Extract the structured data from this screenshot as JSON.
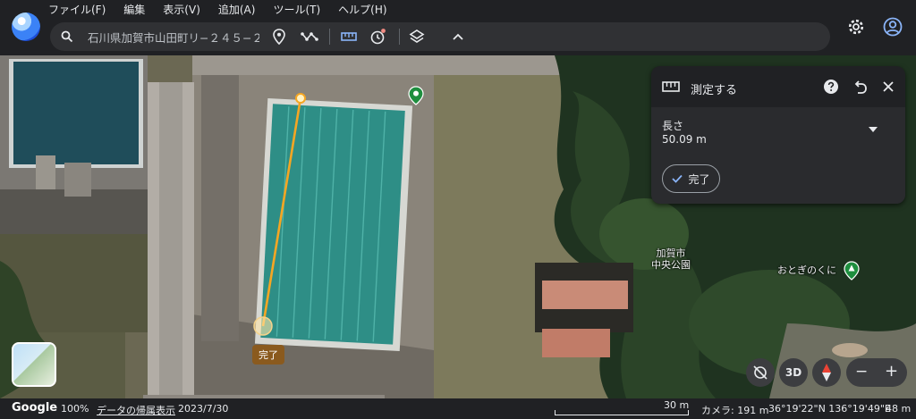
{
  "menu": [
    "ファイル(F)",
    "編集",
    "表示(V)",
    "追加(A)",
    "ツール(T)",
    "ヘルプ(H)"
  ],
  "search": {
    "value": "石川県加賀市山田町リ−２４５−２"
  },
  "toolbar": {
    "icons": [
      "placemark-icon",
      "path-icon",
      "ruler-icon",
      "history-icon",
      "layers-icon",
      "chevron-up-icon"
    ],
    "right": [
      "settings-icon",
      "account-icon"
    ]
  },
  "measure": {
    "title": "測定する",
    "length_label": "長さ",
    "length_value": "50.09 m",
    "done_label": "完了"
  },
  "map": {
    "done_tag": "完了",
    "park_label_line1": "加賀市",
    "park_label_line2": "中央公園",
    "place_label": "おとぎのくに",
    "accent": "#f5a623",
    "pin_color": "#1e8e3e"
  },
  "controls": {
    "three_d": "3D",
    "zoom_out": "−",
    "zoom_in": "+"
  },
  "status": {
    "brand": "Google",
    "zoom": "100%",
    "attribution": "データの帰属表示",
    "date": "2023/7/30",
    "scale": "30 m",
    "camera": "カメラ: 191 m",
    "coords": "36°19'22\"N 136°19'49\"E",
    "elevation": "48 m"
  }
}
